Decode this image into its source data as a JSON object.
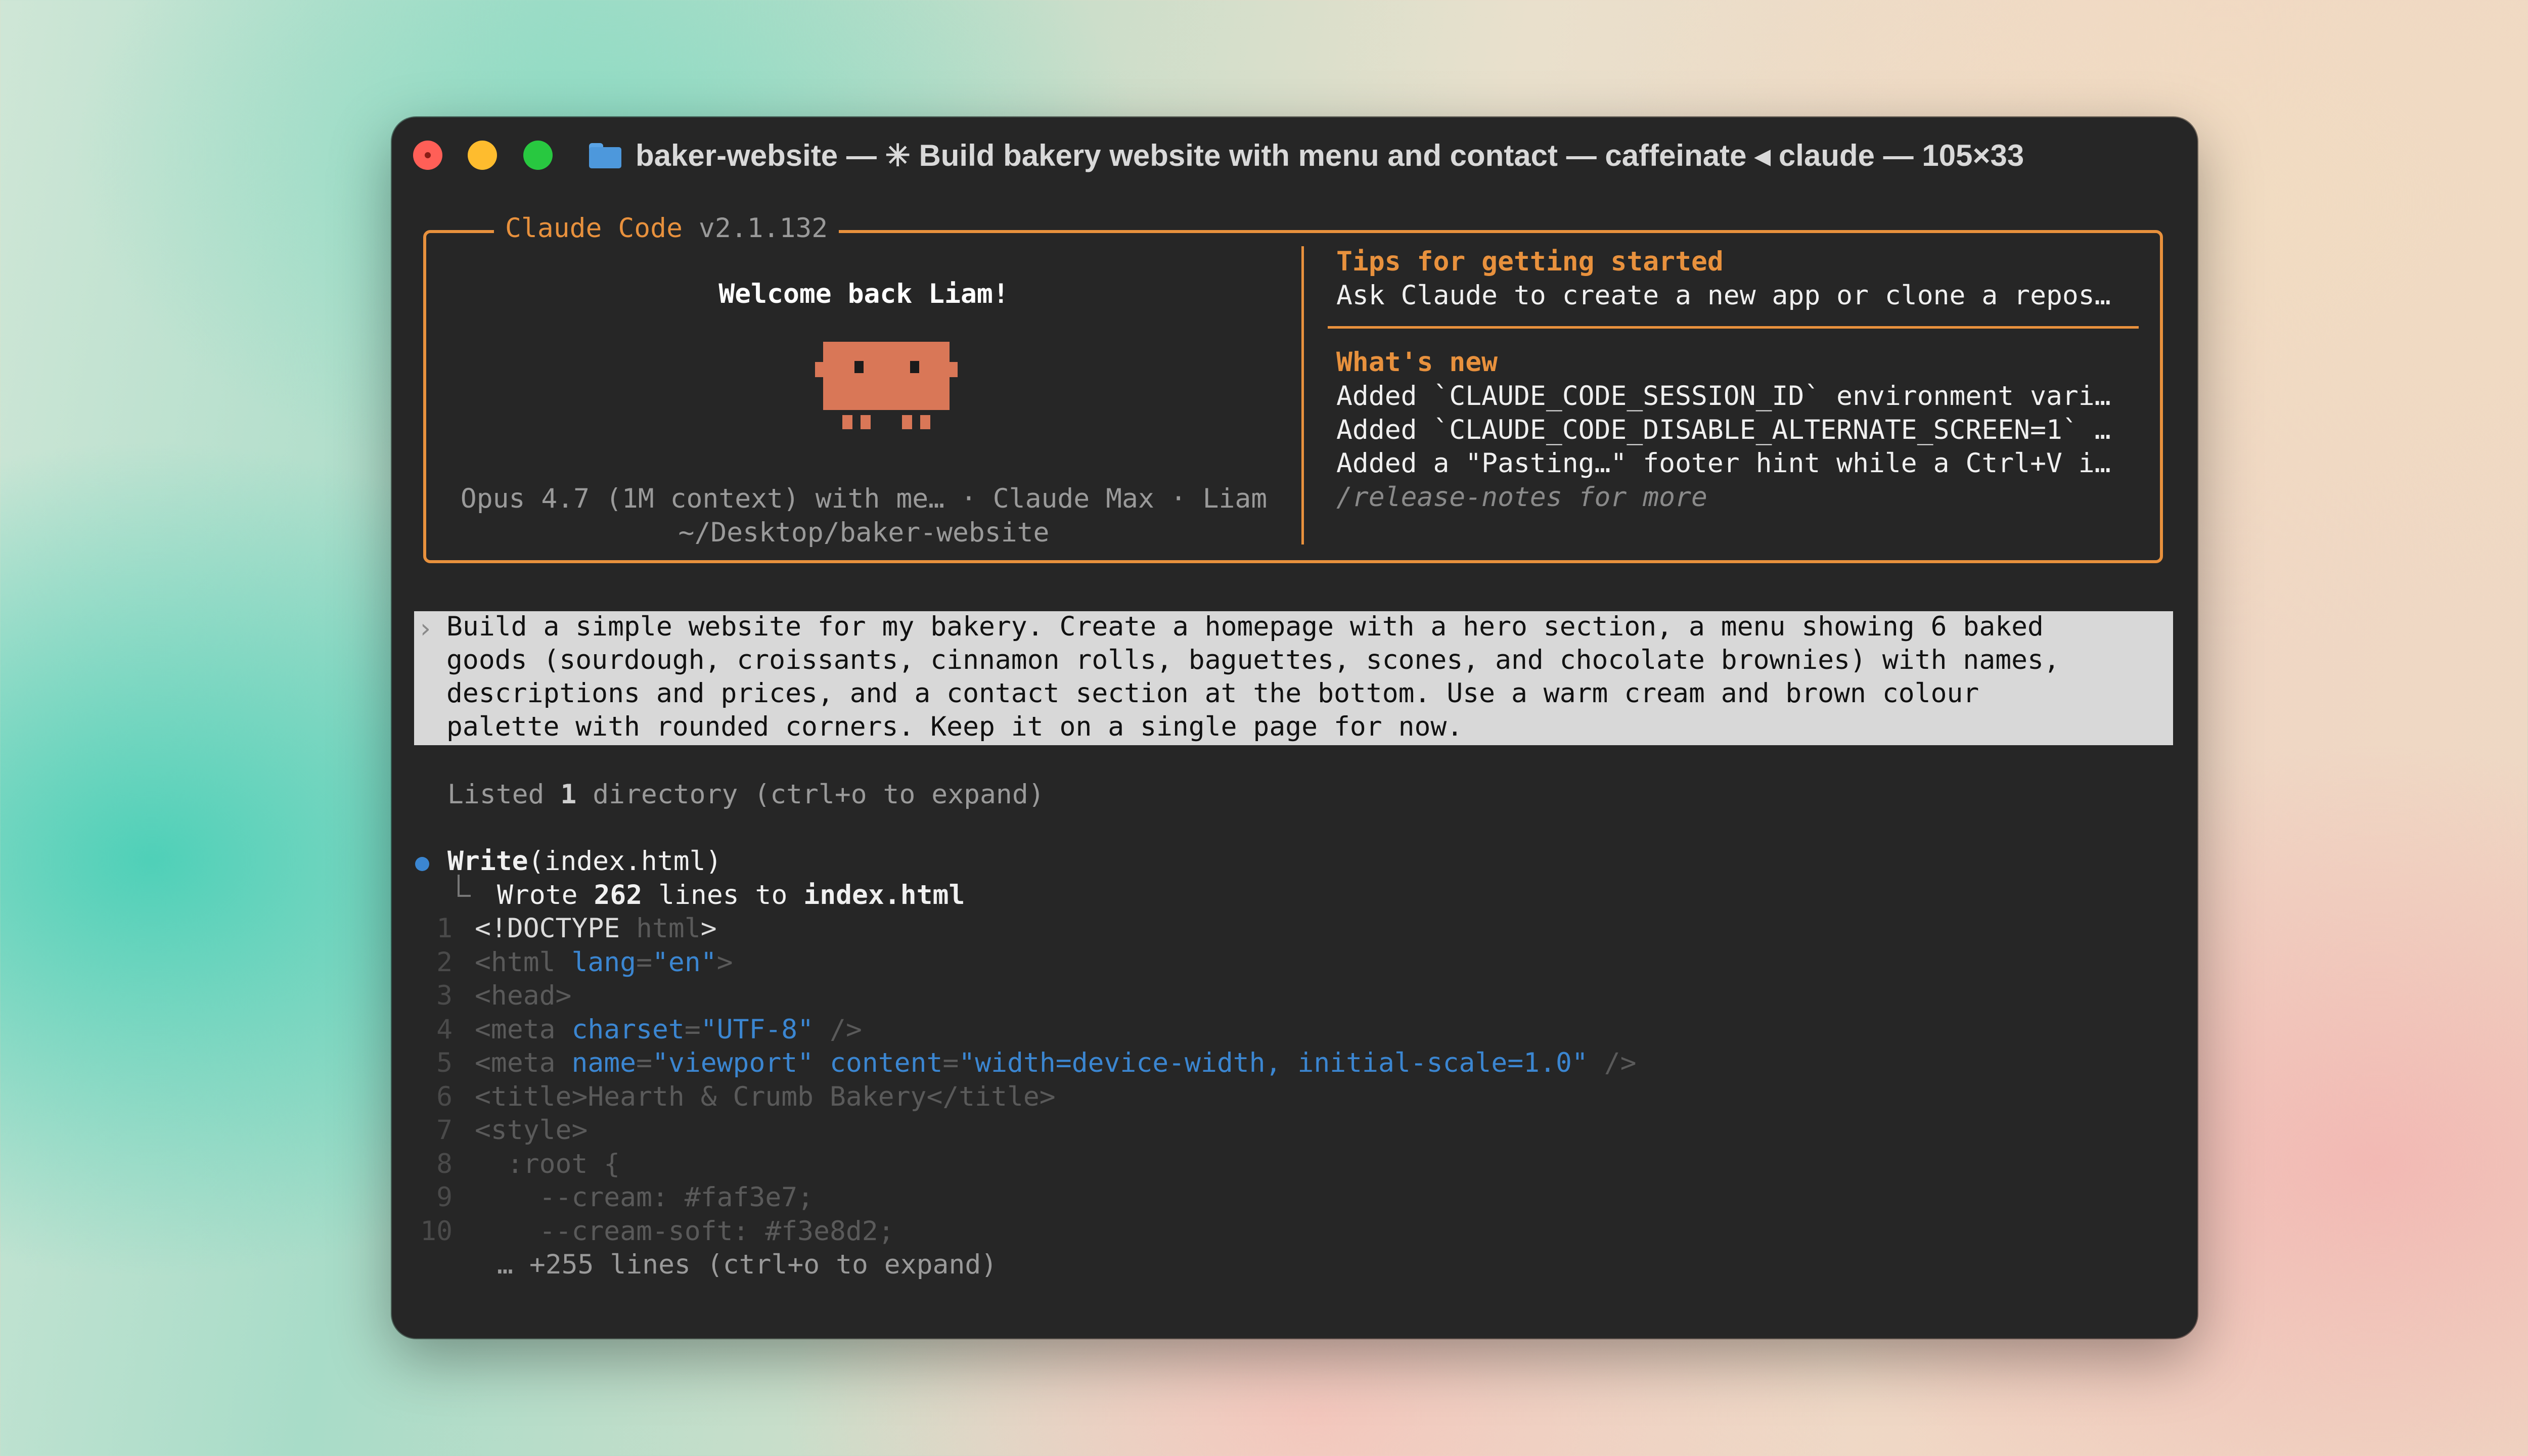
{
  "window": {
    "title": "baker-website — ✳ Build bakery website with menu and contact — caffeinate ◂ claude — 105×33"
  },
  "welcome_box": {
    "app_name": "Claude Code",
    "version": "v2.1.132",
    "welcome": "Welcome back Liam!",
    "model_line": "Opus 4.7 (1M context) with me… · Claude Max · Liam",
    "cwd": "~/Desktop/baker-website",
    "tips_heading": "Tips for getting started",
    "tips_text": "Ask Claude to create a new app or clone a repos…",
    "whats_new_heading": "What's new",
    "whats_new": [
      "Added `CLAUDE_CODE_SESSION_ID` environment vari…",
      "Added `CLAUDE_CODE_DISABLE_ALTERNATE_SCREEN=1` …",
      "Added a \"Pasting…\" footer hint while a Ctrl+V i…"
    ],
    "release_notes": "/release-notes for more"
  },
  "prompt": {
    "chevron": "›",
    "lines": [
      "Build a simple website for my bakery. Create a homepage with a hero section, a menu showing 6 baked",
      "goods (sourdough, croissants, cinnamon rolls, baguettes, scones, and chocolate brownies) with names,",
      "descriptions and prices, and a contact section at the bottom. Use a warm cream and brown colour",
      "palette with rounded corners. Keep it on a single page for now."
    ]
  },
  "listed": {
    "prefix": "Listed ",
    "count": "1",
    "suffix": " directory (ctrl+o to expand)"
  },
  "tool": {
    "name": "Write",
    "arg": "(index.html)",
    "result_prefix": "Wrote ",
    "result_count": "262",
    "result_mid": " lines to ",
    "result_file": "index.html"
  },
  "code": {
    "nums": [
      "1",
      "2",
      "3",
      "4",
      "5",
      "6",
      "7",
      "8",
      "9",
      "10"
    ],
    "l1": {
      "a": "<!DOCTYPE ",
      "b": "html",
      "c": ">"
    },
    "l2": {
      "a": "<html ",
      "attr": "lang",
      "eq": "=",
      "val": "\"en\"",
      "end": ">"
    },
    "l3": "<head>",
    "l4": {
      "a": "<meta ",
      "attr": "charset",
      "eq": "=",
      "val": "\"UTF-8\"",
      "end": " />"
    },
    "l5": {
      "a": "<meta ",
      "attr1": "name",
      "eq1": "=",
      "val1": "\"viewport\"",
      "sp": " ",
      "attr2": "content",
      "eq2": "=",
      "val2": "\"width=device-width, initial-scale=1.0\"",
      "end": " />"
    },
    "l6": "<title>Hearth & Crumb Bakery</title>",
    "l7": "<style>",
    "l8": "  :root {",
    "l9": "    --cream: #faf3e7;",
    "l10": "    --cream-soft: #f3e8d2;",
    "more": "… +255 lines (ctrl+o to expand)"
  }
}
